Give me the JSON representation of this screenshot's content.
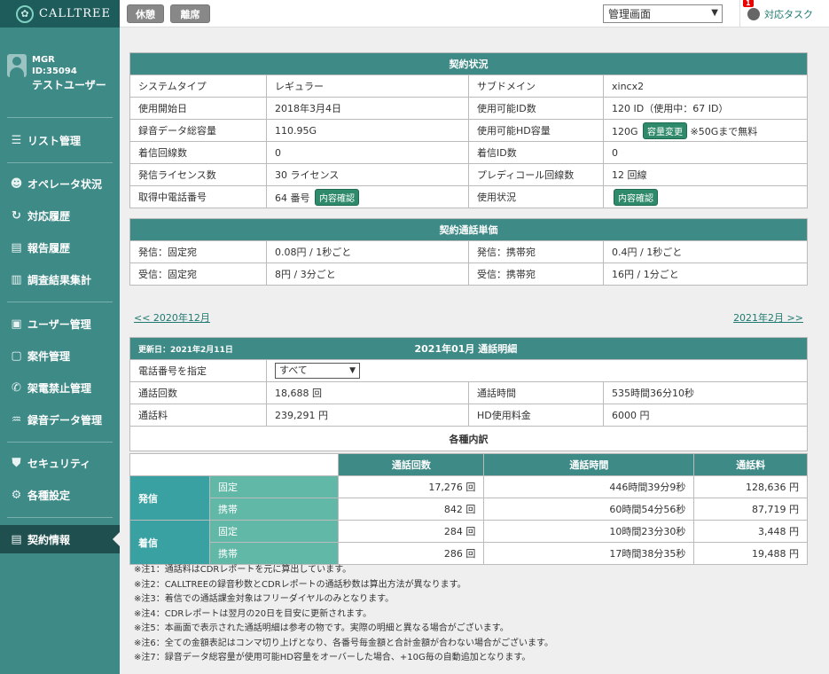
{
  "topbar": {
    "logo": "CALLTREE",
    "btn1": "休憩",
    "btn2": "離席",
    "screen_select": "管理画面",
    "task_badge": "1",
    "task_label": "対応タスク"
  },
  "user": {
    "role": "MGR",
    "id": "ID:35094",
    "name": "テストユーザー"
  },
  "nav": [
    "リスト管理",
    "オペレータ状況",
    "対応履歴",
    "報告履歴",
    "調査結果集計",
    "ユーザー管理",
    "案件管理",
    "架電禁止管理",
    "録音データ管理",
    "セキュリティ",
    "各種設定",
    "契約情報"
  ],
  "contract": {
    "title": "契約状況",
    "rows": [
      [
        "システムタイプ",
        "レギュラー",
        "サブドメイン",
        "xincx2"
      ],
      [
        "使用開始日",
        "2018年3月4日",
        "使用可能ID数",
        "120 ID（使用中：67 ID）"
      ],
      [
        "録音データ総容量",
        "110.95G",
        "使用可能HD容量",
        "120G"
      ],
      [
        "着信回線数",
        "0",
        "着信ID数",
        "0"
      ],
      [
        "発信ライセンス数",
        "30 ライセンス",
        "プレディコール回線数",
        "12 回線"
      ],
      [
        "取得中電話番号",
        "64 番号",
        "使用状況",
        ""
      ]
    ],
    "hd_change": "容量変更",
    "hd_note": "※50Gまで無料",
    "confirm": "内容確認"
  },
  "rates": {
    "title": "契約通話単価",
    "rows": [
      [
        "発信：固定宛",
        "0.08円 / 1秒ごと",
        "発信：携帯宛",
        "0.4円 / 1秒ごと"
      ],
      [
        "受信：固定宛",
        "8円 / 3分ごと",
        "受信：携帯宛",
        "16円 / 1分ごと"
      ]
    ]
  },
  "pager": {
    "prev": "<< 2020年12月",
    "next": "2021年2月 >>"
  },
  "detail": {
    "updated": "更新日：2021年2月11日",
    "title": "2021年01月 通話明細",
    "phone_label": "電話番号を指定",
    "phone_value": "すべて",
    "rows": [
      [
        "通話回数",
        "18,688 回",
        "通話時間",
        "535時間36分10秒"
      ],
      [
        "通話料",
        "239,291 円",
        "HD使用料金",
        "6000 円"
      ]
    ],
    "breakdown": "各種内訳",
    "cols": [
      "通話回数",
      "通話時間",
      "通話料"
    ],
    "groups": [
      {
        "name": "発信",
        "items": [
          [
            "固定",
            "17,276 回",
            "446時間39分9秒",
            "128,636 円"
          ],
          [
            "携帯",
            "842 回",
            "60時間54分56秒",
            "87,719 円"
          ]
        ]
      },
      {
        "name": "着信",
        "items": [
          [
            "固定",
            "284 回",
            "10時間23分30秒",
            "3,448 円"
          ],
          [
            "携帯",
            "286 回",
            "17時間38分35秒",
            "19,488 円"
          ]
        ]
      }
    ]
  },
  "notes": [
    "※注1：通話料はCDRレポートを元に算出しています。",
    "※注2：CALLTREEの録音秒数とCDRレポートの通話秒数は算出方法が異なります。",
    "※注3：着信での通話課金対象はフリーダイヤルのみとなります。",
    "※注4：CDRレポートは翌月の20日を目安に更新されます。",
    "※注5：本画面で表示された通話明細は参考の物です。実際の明細と異なる場合がございます。",
    "※注6：全ての金額表記はコンマ切り上げとなり、各番号毎金額と合計金額が合わない場合がございます。",
    "※注7：録音データ総容量が使用可能HD容量をオーバーした場合、+10G毎の自動追加となります。"
  ]
}
